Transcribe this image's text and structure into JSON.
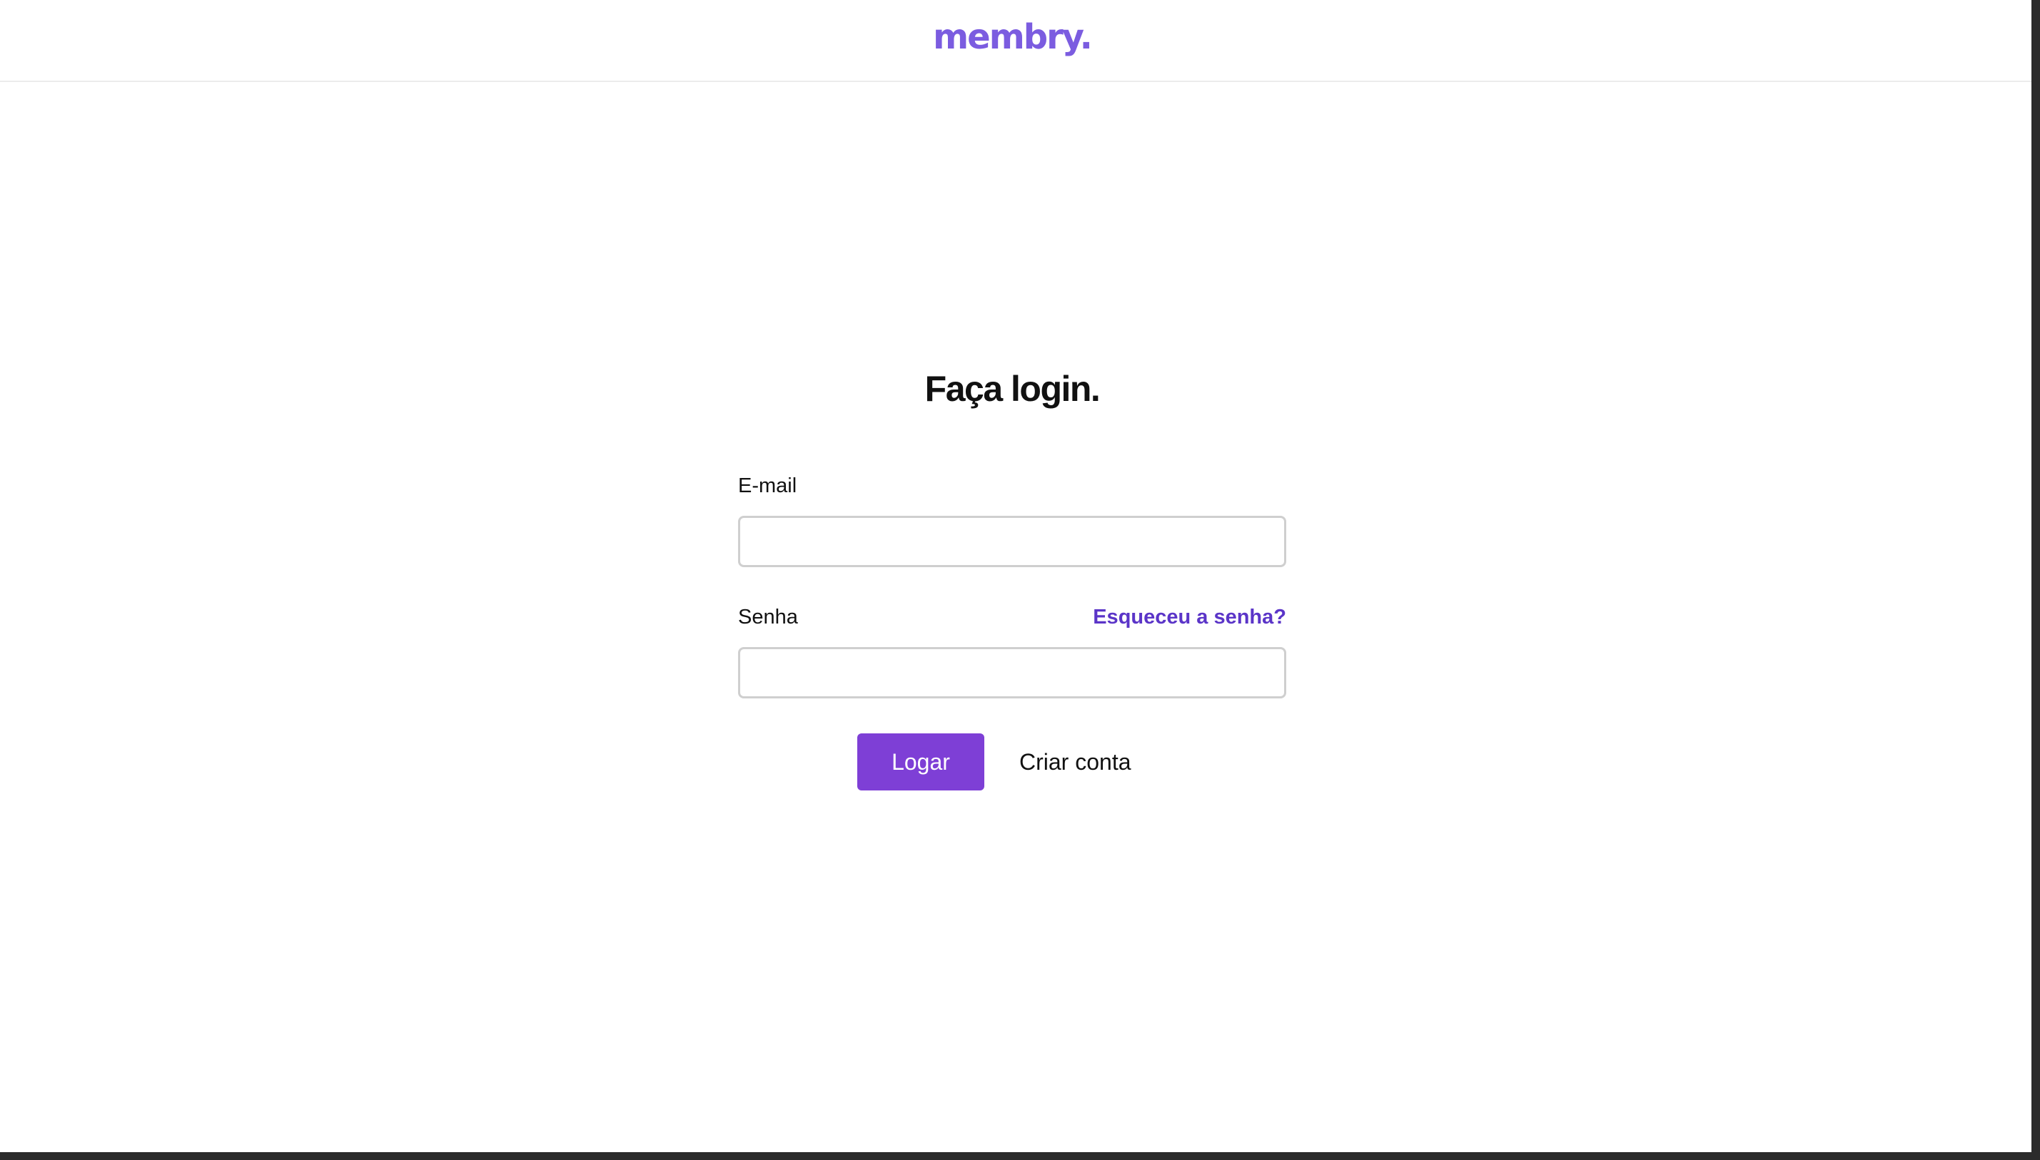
{
  "header": {
    "logo_text": "membry.",
    "brand_color": "#7b5ce0"
  },
  "login": {
    "title": "Faça login.",
    "email_label": "E-mail",
    "email_value": "",
    "email_placeholder": "",
    "password_label": "Senha",
    "password_value": "",
    "password_placeholder": "",
    "forgot_password_link": "Esqueceu a senha?",
    "submit_button_label": "Logar",
    "create_account_label": "Criar conta"
  },
  "colors": {
    "primary_button": "#7e3fd6",
    "link": "#5b35c8",
    "input_border": "#cfcfcf"
  }
}
